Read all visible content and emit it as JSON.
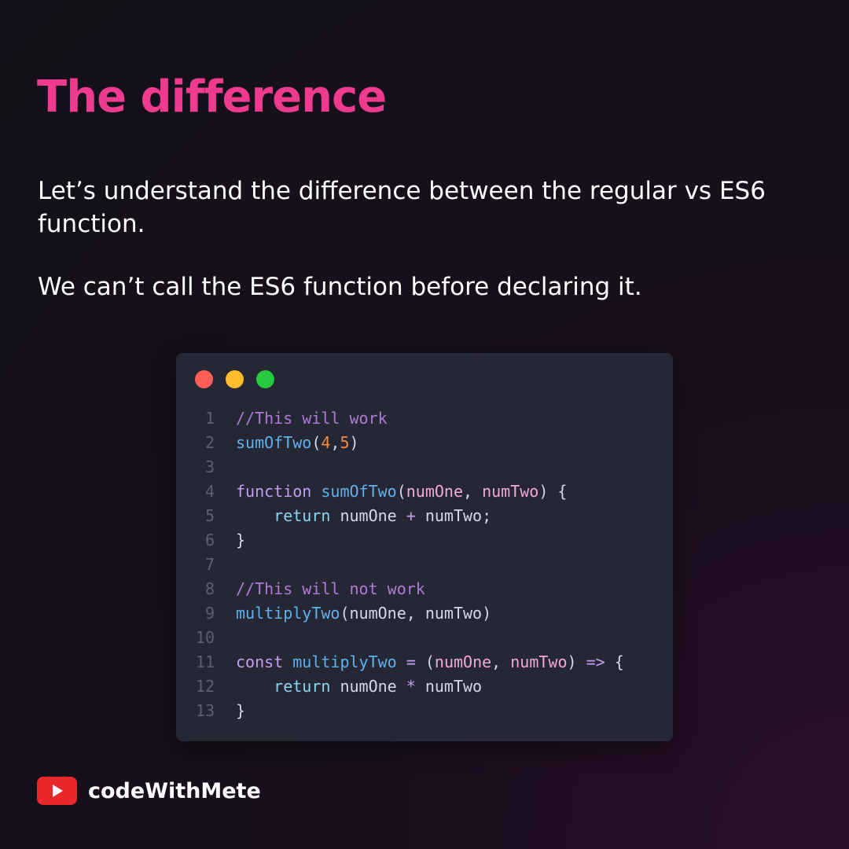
{
  "title": "The difference",
  "paragraphs": [
    "Let’s understand the difference between the regular vs ES6 function.",
    "We can’t call the ES6 function before declaring it."
  ],
  "code": {
    "window_dots": [
      "red",
      "yellow",
      "green"
    ],
    "lines": [
      {
        "num": "1",
        "tokens": [
          {
            "t": "comment",
            "v": "//This will work"
          }
        ]
      },
      {
        "num": "2",
        "tokens": [
          {
            "t": "fn",
            "v": "sumOfTwo"
          },
          {
            "t": "text",
            "v": "("
          },
          {
            "t": "num",
            "v": "4"
          },
          {
            "t": "text",
            "v": ","
          },
          {
            "t": "num",
            "v": "5"
          },
          {
            "t": "text",
            "v": ")"
          }
        ]
      },
      {
        "num": "3",
        "tokens": []
      },
      {
        "num": "4",
        "tokens": [
          {
            "t": "kw",
            "v": "function"
          },
          {
            "t": "text",
            "v": " "
          },
          {
            "t": "fn",
            "v": "sumOfTwo"
          },
          {
            "t": "text",
            "v": "("
          },
          {
            "t": "param",
            "v": "numOne"
          },
          {
            "t": "text",
            "v": ", "
          },
          {
            "t": "param",
            "v": "numTwo"
          },
          {
            "t": "text",
            "v": ") {"
          }
        ]
      },
      {
        "num": "5",
        "tokens": [
          {
            "t": "text",
            "v": "    "
          },
          {
            "t": "ret",
            "v": "return"
          },
          {
            "t": "text",
            "v": " numOne "
          },
          {
            "t": "op",
            "v": "+"
          },
          {
            "t": "text",
            "v": " numTwo;"
          }
        ]
      },
      {
        "num": "6",
        "tokens": [
          {
            "t": "text",
            "v": "}"
          }
        ]
      },
      {
        "num": "7",
        "tokens": []
      },
      {
        "num": "8",
        "tokens": [
          {
            "t": "comment",
            "v": "//This will not work"
          }
        ]
      },
      {
        "num": "9",
        "tokens": [
          {
            "t": "fn",
            "v": "multiplyTwo"
          },
          {
            "t": "text",
            "v": "(numOne, numTwo)"
          }
        ]
      },
      {
        "num": "10",
        "tokens": []
      },
      {
        "num": "11",
        "tokens": [
          {
            "t": "kw",
            "v": "const"
          },
          {
            "t": "text",
            "v": " "
          },
          {
            "t": "fn",
            "v": "multiplyTwo"
          },
          {
            "t": "text",
            "v": " "
          },
          {
            "t": "op",
            "v": "="
          },
          {
            "t": "text",
            "v": " ("
          },
          {
            "t": "param",
            "v": "numOne"
          },
          {
            "t": "text",
            "v": ", "
          },
          {
            "t": "param",
            "v": "numTwo"
          },
          {
            "t": "text",
            "v": ") "
          },
          {
            "t": "op",
            "v": "=>"
          },
          {
            "t": "text",
            "v": " {"
          }
        ]
      },
      {
        "num": "12",
        "tokens": [
          {
            "t": "text",
            "v": "    "
          },
          {
            "t": "ret",
            "v": "return"
          },
          {
            "t": "text",
            "v": " numOne "
          },
          {
            "t": "op",
            "v": "*"
          },
          {
            "t": "text",
            "v": " numTwo"
          }
        ]
      },
      {
        "num": "13",
        "tokens": [
          {
            "t": "text",
            "v": "}"
          }
        ]
      }
    ]
  },
  "footer": {
    "icon": "youtube-icon",
    "brand": "codeWithMete"
  },
  "colors": {
    "title": "#ee3a8f",
    "code_bg": "#252734",
    "youtube_red": "#e8282b"
  }
}
